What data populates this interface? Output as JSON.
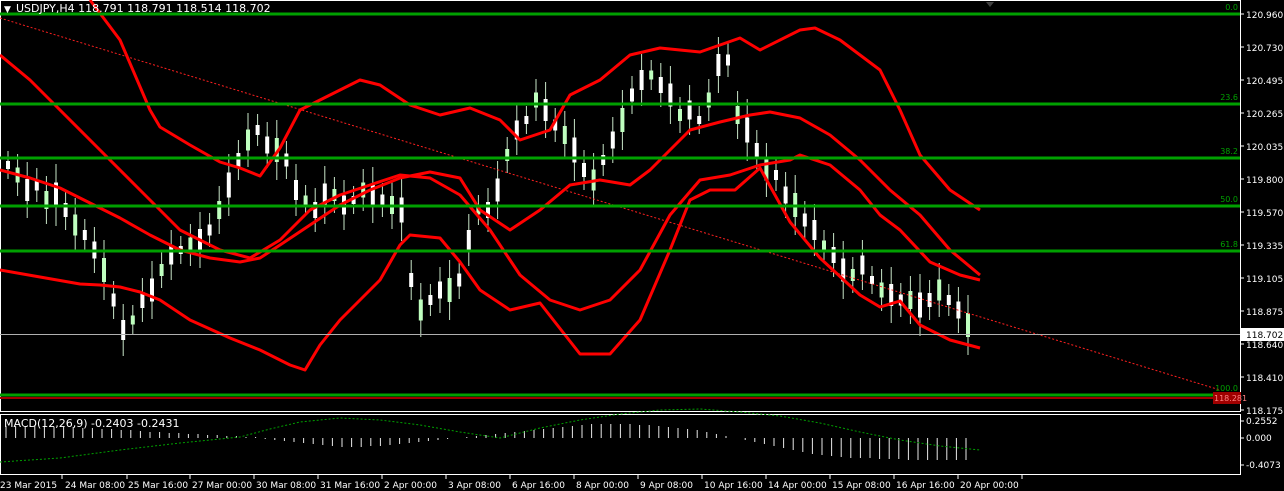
{
  "header": {
    "arrow_glyph": "▼",
    "title": "USDJPY,H4  118.791 118.791 118.514 118.702"
  },
  "price_axis": {
    "labels": [
      "120.960",
      "120.730",
      "120.495",
      "120.265",
      "120.035",
      "119.800",
      "119.570",
      "119.335",
      "119.105",
      "118.875",
      "118.640",
      "118.410",
      "118.175"
    ],
    "current_price": "118.702",
    "red_marker": "118.281"
  },
  "fibo_levels": [
    "0.0",
    "23.6",
    "38.2",
    "50.0",
    "61.8",
    "100.0"
  ],
  "macd": {
    "title": "MACD(12,26,9) -0.2403 -0.2431",
    "axis_labels": [
      "0.2552",
      "0.000",
      "-0.4073"
    ]
  },
  "time_axis": {
    "labels": [
      "23 Mar 2015",
      "24 Mar 08:00",
      "25 Mar 16:00",
      "27 Mar 00:00",
      "30 Mar 08:00",
      "31 Mar 16:00",
      "2 Apr 00:00",
      "3 Apr 08:00",
      "6 Apr 16:00",
      "8 Apr 00:00",
      "9 Apr 08:00",
      "10 Apr 16:00",
      "14 Apr 00:00",
      "15 Apr 08:00",
      "16 Apr 16:00",
      "20 Apr 00:00"
    ]
  },
  "colors": {
    "background": "#000000",
    "fibo": "#00a000",
    "bands": "#ff0000",
    "trend": "#ff2020",
    "bull": "#ffffff",
    "bear": "#bfffbf",
    "wick": "#c8e6c8",
    "axis": "#ffffff"
  }
}
